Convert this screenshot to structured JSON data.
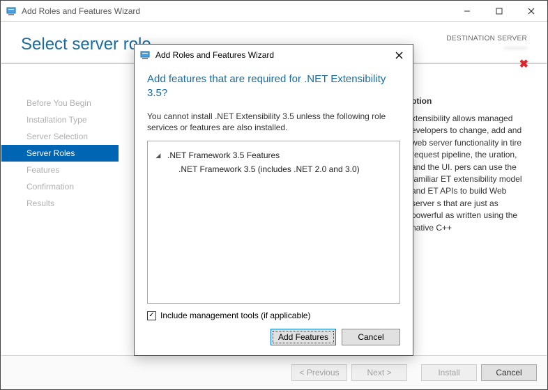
{
  "window": {
    "title": "Add Roles and Features Wizard"
  },
  "page": {
    "title": "Select server role",
    "destination_label": "DESTINATION SERVER",
    "destination_server": "———"
  },
  "sidebar": {
    "items": [
      {
        "label": "Before You Begin"
      },
      {
        "label": "Installation Type"
      },
      {
        "label": "Server Selection"
      },
      {
        "label": "Server Roles"
      },
      {
        "label": "Features"
      },
      {
        "label": "Confirmation"
      },
      {
        "label": "Results"
      }
    ],
    "active_index": 3
  },
  "description": {
    "heading": "ption",
    "body": "xtensibility allows managed evelopers to change, add and web server functionality in tire request pipeline, the uration, and the UI. pers can use the familiar ET extensibility model and ET APIs to build Web server s that are just as powerful as written using the native C++"
  },
  "footer": {
    "previous": "< Previous",
    "next": "Next >",
    "install": "Install",
    "cancel": "Cancel"
  },
  "modal": {
    "title": "Add Roles and Features Wizard",
    "heading": "Add features that are required for .NET Extensibility 3.5?",
    "text": "You cannot install .NET Extensibility 3.5 unless the following role services or features are also installed.",
    "tree": {
      "parent": ".NET Framework 3.5 Features",
      "child": ".NET Framework 3.5 (includes .NET 2.0 and 3.0)"
    },
    "checkbox_label": "Include management tools (if applicable)",
    "checkbox_checked": true,
    "add_features": "Add Features",
    "cancel": "Cancel"
  }
}
